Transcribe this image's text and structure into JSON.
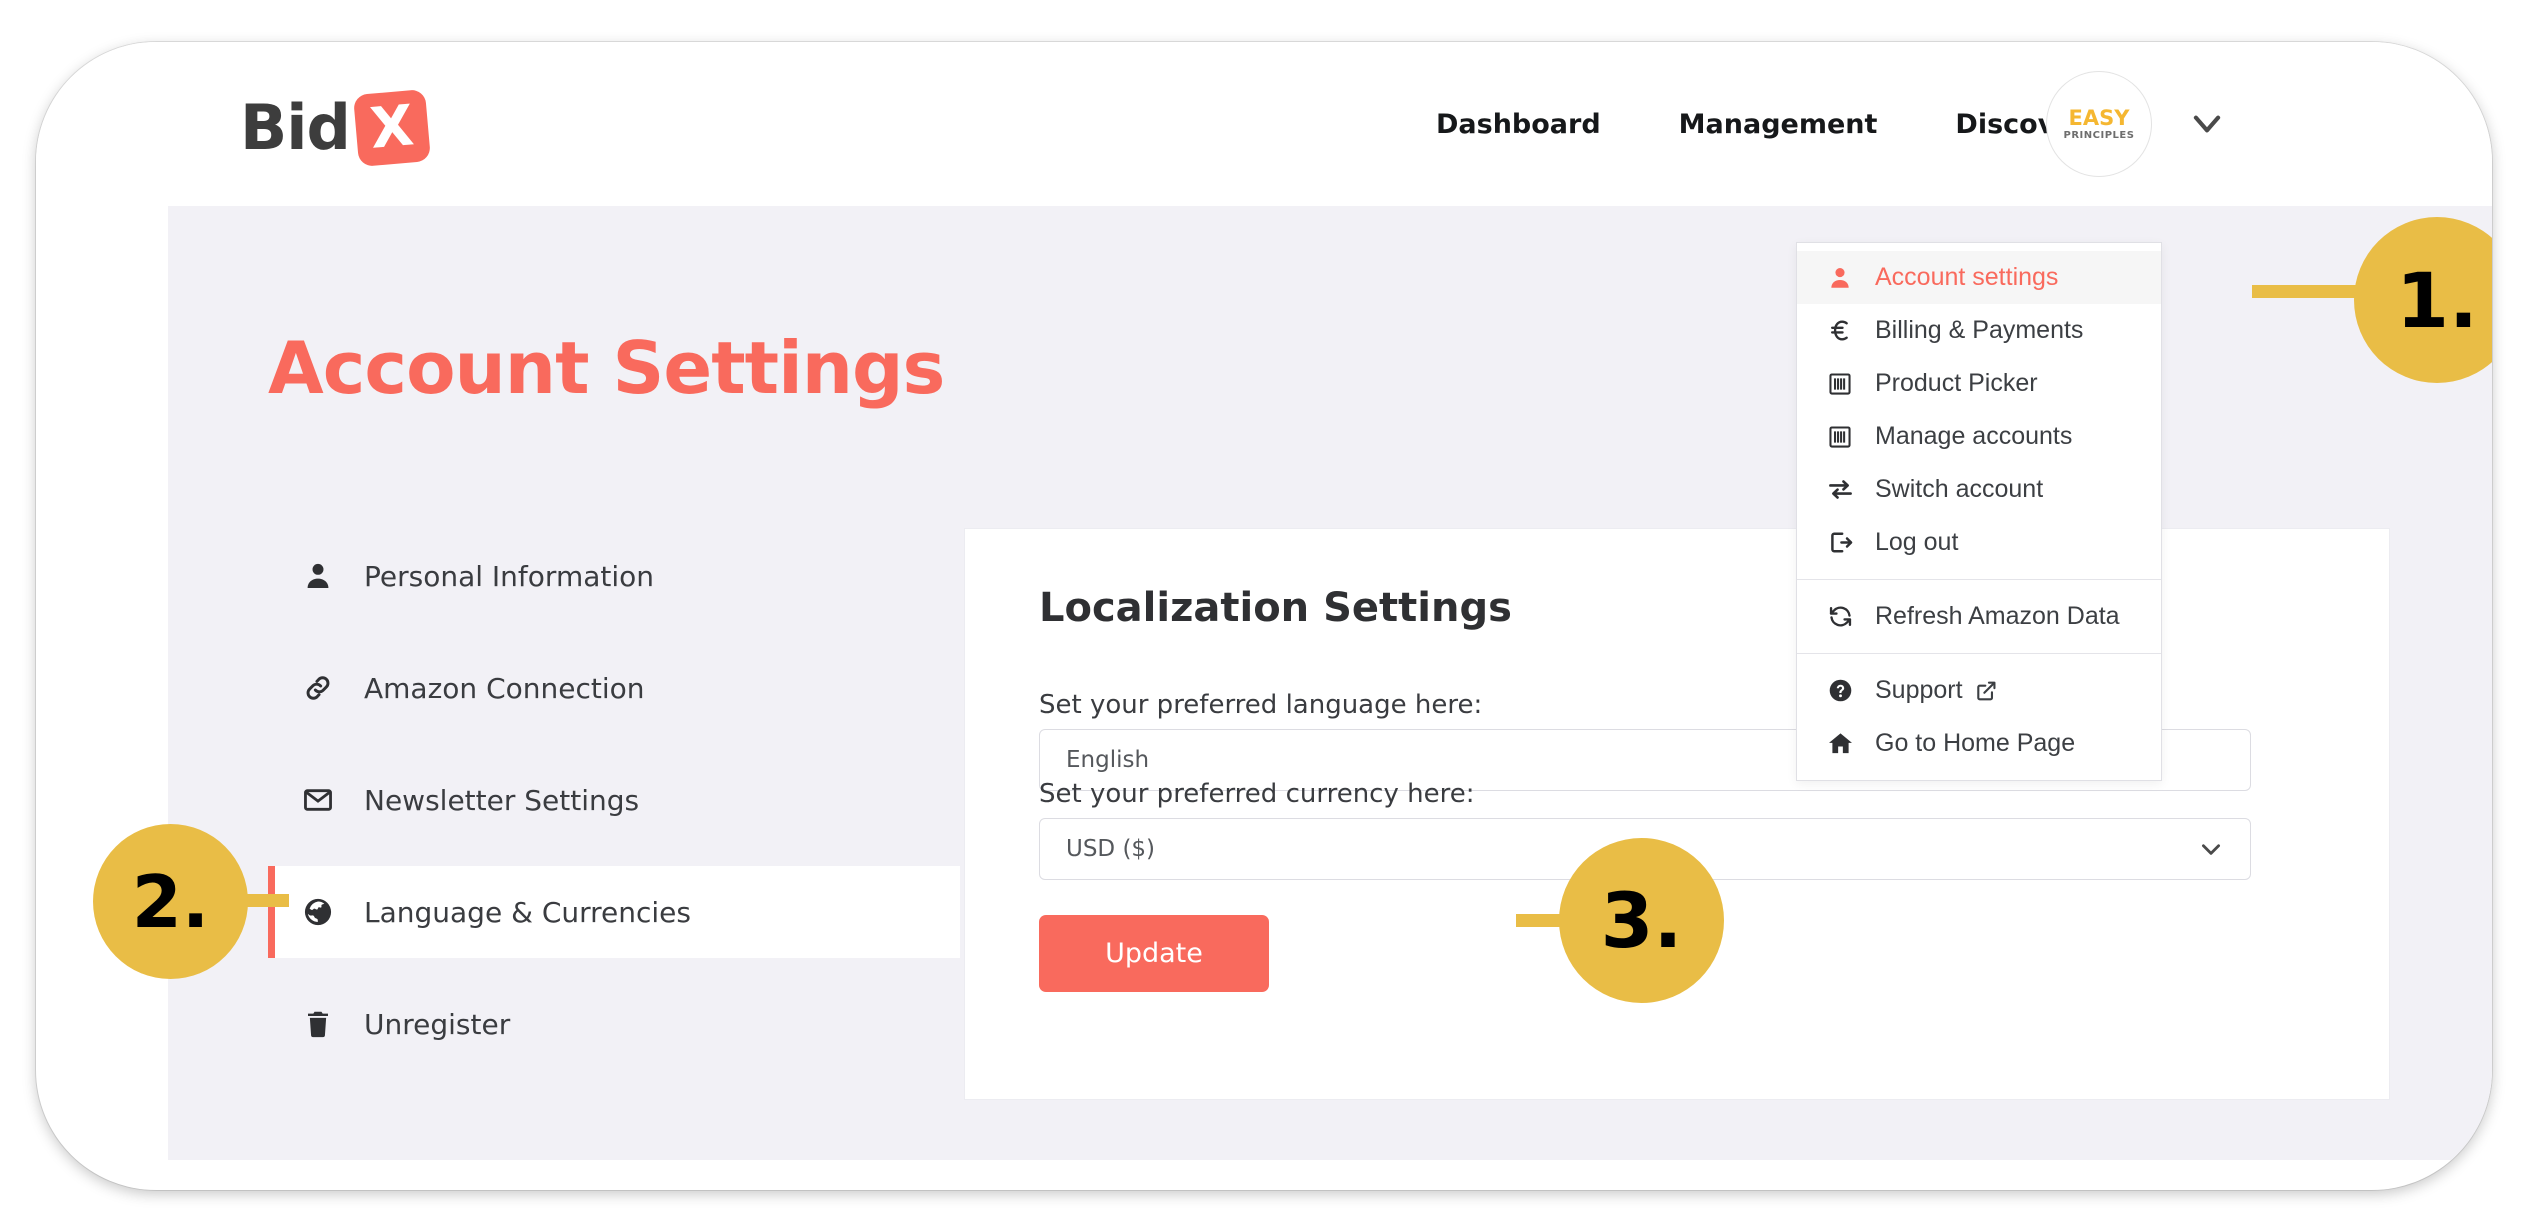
{
  "brand": {
    "name_text": "Bid",
    "mark_letter": "X",
    "mark_color": "#f96a5d"
  },
  "nav": {
    "items": [
      {
        "label": "Dashboard"
      },
      {
        "label": "Management"
      },
      {
        "label": "Discover"
      }
    ]
  },
  "account": {
    "avatar_top": "EASY",
    "avatar_bottom": "PRINCIPLES",
    "caret_icon": "chevron-down-icon"
  },
  "dropdown": {
    "items": [
      {
        "label": "Account settings",
        "icon": "user-icon",
        "highlight": true
      },
      {
        "label": "Billing & Payments",
        "icon": "euro-icon",
        "highlight": false
      },
      {
        "label": "Product Picker",
        "icon": "list-panel-icon",
        "highlight": false
      },
      {
        "label": "Manage accounts",
        "icon": "list-panel-icon",
        "highlight": false
      },
      {
        "label": "Switch account",
        "icon": "switch-arrows-icon",
        "highlight": false
      },
      {
        "label": "Log out",
        "icon": "logout-icon",
        "highlight": false
      }
    ],
    "group2": [
      {
        "label": "Refresh Amazon Data",
        "icon": "refresh-icon"
      }
    ],
    "group3": [
      {
        "label": "Support",
        "icon": "help-circle-icon",
        "external": true
      },
      {
        "label": "Go to Home Page",
        "icon": "home-icon",
        "external": false
      }
    ]
  },
  "page": {
    "title": "Account Settings",
    "title_color": "#f96a5d"
  },
  "sidebar": {
    "items": [
      {
        "label": "Personal Information",
        "icon": "person-icon",
        "active": false
      },
      {
        "label": "Amazon Connection",
        "icon": "link-icon",
        "active": false
      },
      {
        "label": "Newsletter Settings",
        "icon": "envelope-icon",
        "active": false
      },
      {
        "label": "Language & Currencies",
        "icon": "globe-icon",
        "active": true
      },
      {
        "label": "Unregister",
        "icon": "trash-icon",
        "active": false
      }
    ]
  },
  "card": {
    "title": "Localization Settings",
    "language_label": "Set your preferred language here:",
    "language_value": "English",
    "currency_label": "Set your preferred currency here:",
    "currency_value": "USD ($)",
    "update_label": "Update"
  },
  "callouts": [
    {
      "label": "1."
    },
    {
      "label": "2."
    },
    {
      "label": "3."
    }
  ]
}
